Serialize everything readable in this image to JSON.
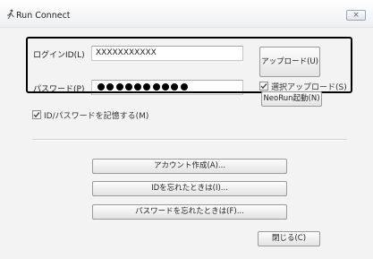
{
  "window": {
    "title": "Run Connect",
    "close_glyph": "×"
  },
  "login": {
    "id_label": "ログインID(L)",
    "id_value": "XXXXXXXXXXX",
    "password_label": "パスワード(P)",
    "password_masked": true
  },
  "options": {
    "remember_label": "ID/パスワードを記憶する(M)",
    "remember_checked": true,
    "select_upload_label": "選択アップロード(S)",
    "select_upload_checked": true
  },
  "buttons": {
    "upload": "アップロード(U)",
    "neorun_launch": "NeoRun起動(N)",
    "create_account": "アカウント作成(A)...",
    "forgot_id": "IDを忘れたときは(I)...",
    "forgot_password": "パスワードを忘れたときは(F)...",
    "close": "閉じる(C)"
  },
  "icons": {
    "app": "runner-icon",
    "close": "close-icon",
    "check": "check-icon"
  }
}
